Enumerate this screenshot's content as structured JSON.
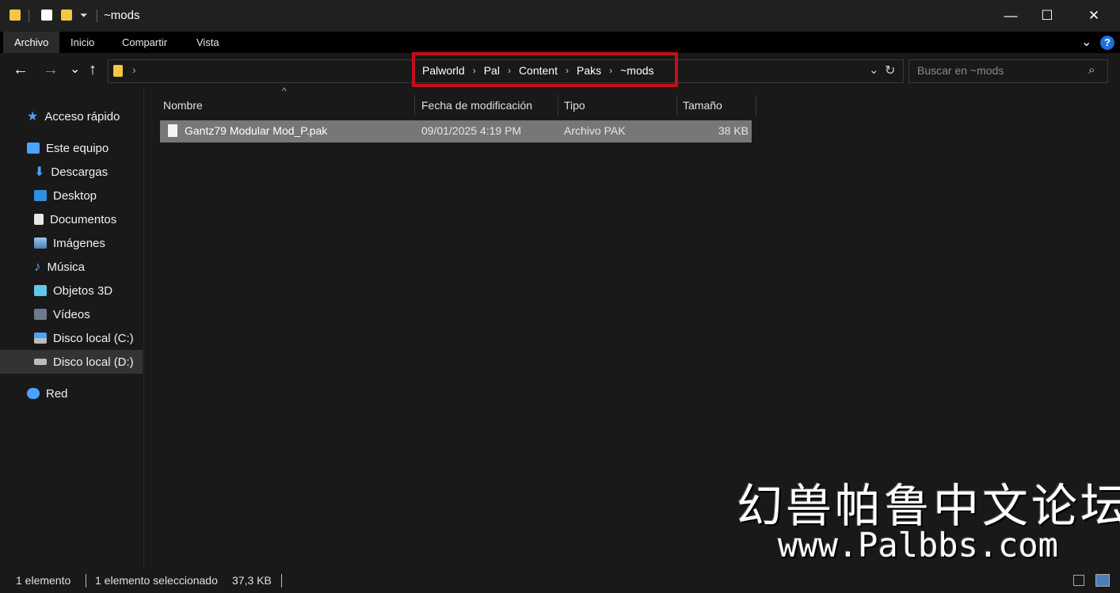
{
  "window": {
    "title": "~mods",
    "minimize_glyph": "—",
    "maximize_glyph": "☐",
    "close_glyph": "✕"
  },
  "ribbon": {
    "tabs": [
      "Archivo",
      "Inicio",
      "Compartir",
      "Vista"
    ],
    "help_glyph": "?"
  },
  "nav": {
    "back_glyph": "←",
    "forward_glyph": "→",
    "recent_glyph": "⌄",
    "up_glyph": "↑",
    "breadcrumb": [
      "Palworld",
      "Pal",
      "Content",
      "Paks",
      "~mods"
    ],
    "breadcrumb_sep": "›",
    "search_placeholder": "Buscar en ~mods"
  },
  "sidebar": {
    "quick_access": "Acceso rápido",
    "this_pc": "Este equipo",
    "items": [
      "Descargas",
      "Desktop",
      "Documentos",
      "Imágenes",
      "Música",
      "Objetos 3D",
      "Vídeos",
      "Disco local (C:)",
      "Disco local (D:)"
    ],
    "network": "Red",
    "selected_item": "Disco local (D:)"
  },
  "columns": [
    "Nombre",
    "Fecha de modificación",
    "Tipo",
    "Tamaño"
  ],
  "files": [
    {
      "name": "Gantz79 Modular Mod_P.pak",
      "modified": "09/01/2025 4:19 PM",
      "type": "Archivo PAK",
      "size": "38 KB"
    }
  ],
  "status": {
    "count": "1 elemento",
    "selected": "1 elemento seleccionado",
    "size": "37,3 KB"
  },
  "watermark": {
    "chinese": "幻兽帕鲁中文论坛",
    "url": "www.Palbbs.com"
  },
  "colors": {
    "highlight_border": "#c40f1a",
    "selected_row": "#777777",
    "star": "#4aa3ff",
    "folder": "#f2c744"
  }
}
